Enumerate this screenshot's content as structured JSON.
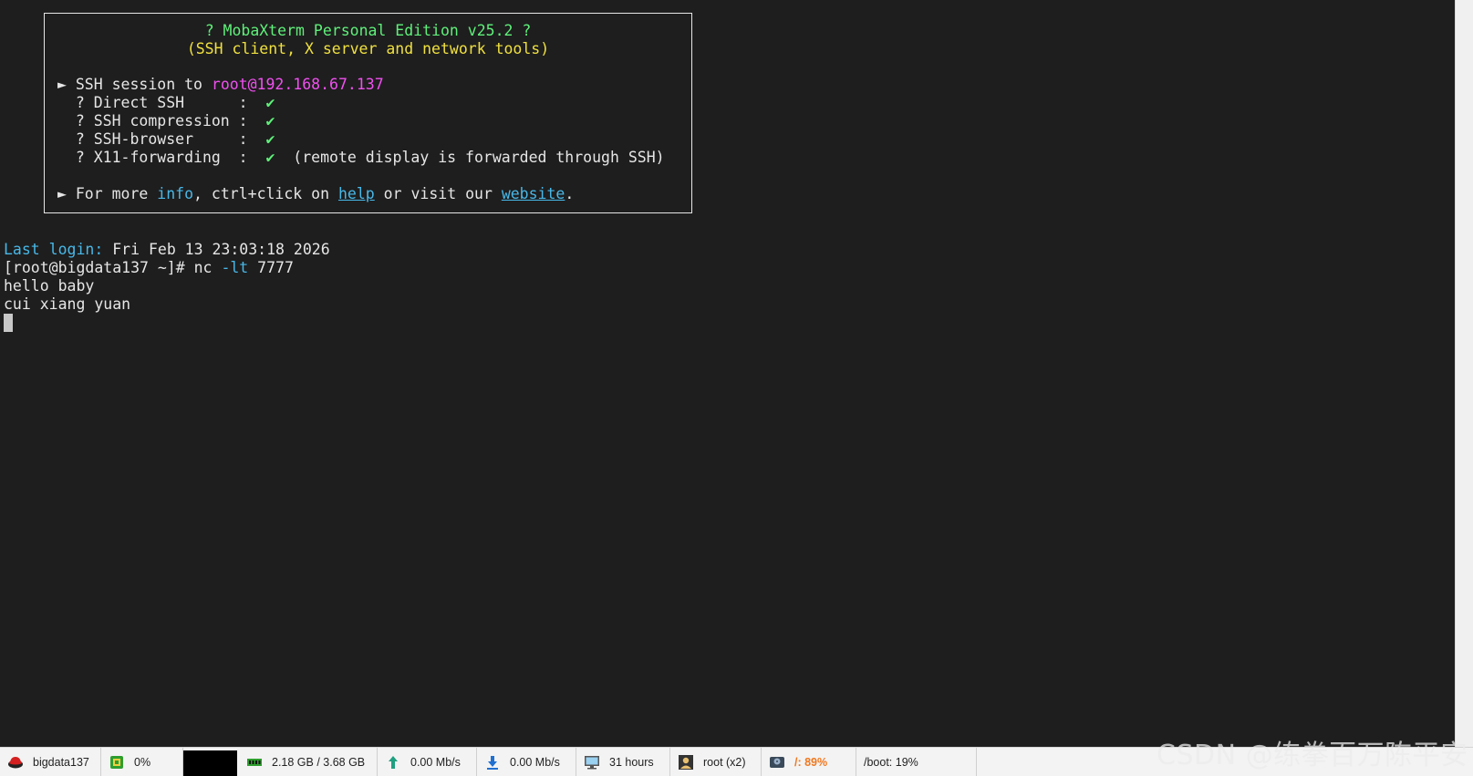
{
  "banner": {
    "title": "? MobaXterm Personal Edition v25.2 ?",
    "subtitle": "(SSH client, X server and network tools)",
    "session_prefix": "► SSH session to ",
    "session_target": "root@192.168.67.137",
    "features": [
      {
        "label": "  ? Direct SSH      :  ",
        "check": "✔",
        "note": ""
      },
      {
        "label": "  ? SSH compression :  ",
        "check": "✔",
        "note": ""
      },
      {
        "label": "  ? SSH-browser     :  ",
        "check": "✔",
        "note": ""
      },
      {
        "label": "  ? X11-forwarding  :  ",
        "check": "✔",
        "note": "  (remote display is forwarded through SSH)"
      }
    ],
    "more_prefix": "► For more ",
    "more_info": "info",
    "more_mid1": ", ctrl+click on ",
    "more_help": "help",
    "more_mid2": " or visit our ",
    "more_website": "website",
    "more_end": "."
  },
  "terminal": {
    "last_login_label": "Last login:",
    "last_login_value": " Fri Feb 13 23:03:18 2026",
    "prompt": "[root@bigdata137 ~]# ",
    "command": "nc ",
    "command_flag": "-lt",
    "command_arg": " 7777",
    "output": [
      "hello baby",
      "cui xiang yuan"
    ]
  },
  "statusbar": {
    "host": "bigdata137",
    "cpu": "0%",
    "memory": "2.18 GB / 3.68 GB",
    "upload": "0.00 Mb/s",
    "download": "0.00 Mb/s",
    "uptime": "31 hours",
    "users": "root (x2)",
    "disk_root": "/: 89%",
    "disk_boot": "/boot: 19%"
  },
  "watermark": "CSDN @练拳百万陈平安",
  "colors": {
    "background": "#1e1e1e",
    "green": "#5ff07a",
    "yellow": "#f0e040",
    "magenta": "#f050f0",
    "cyan": "#48b8e8",
    "warning": "#f07820"
  }
}
